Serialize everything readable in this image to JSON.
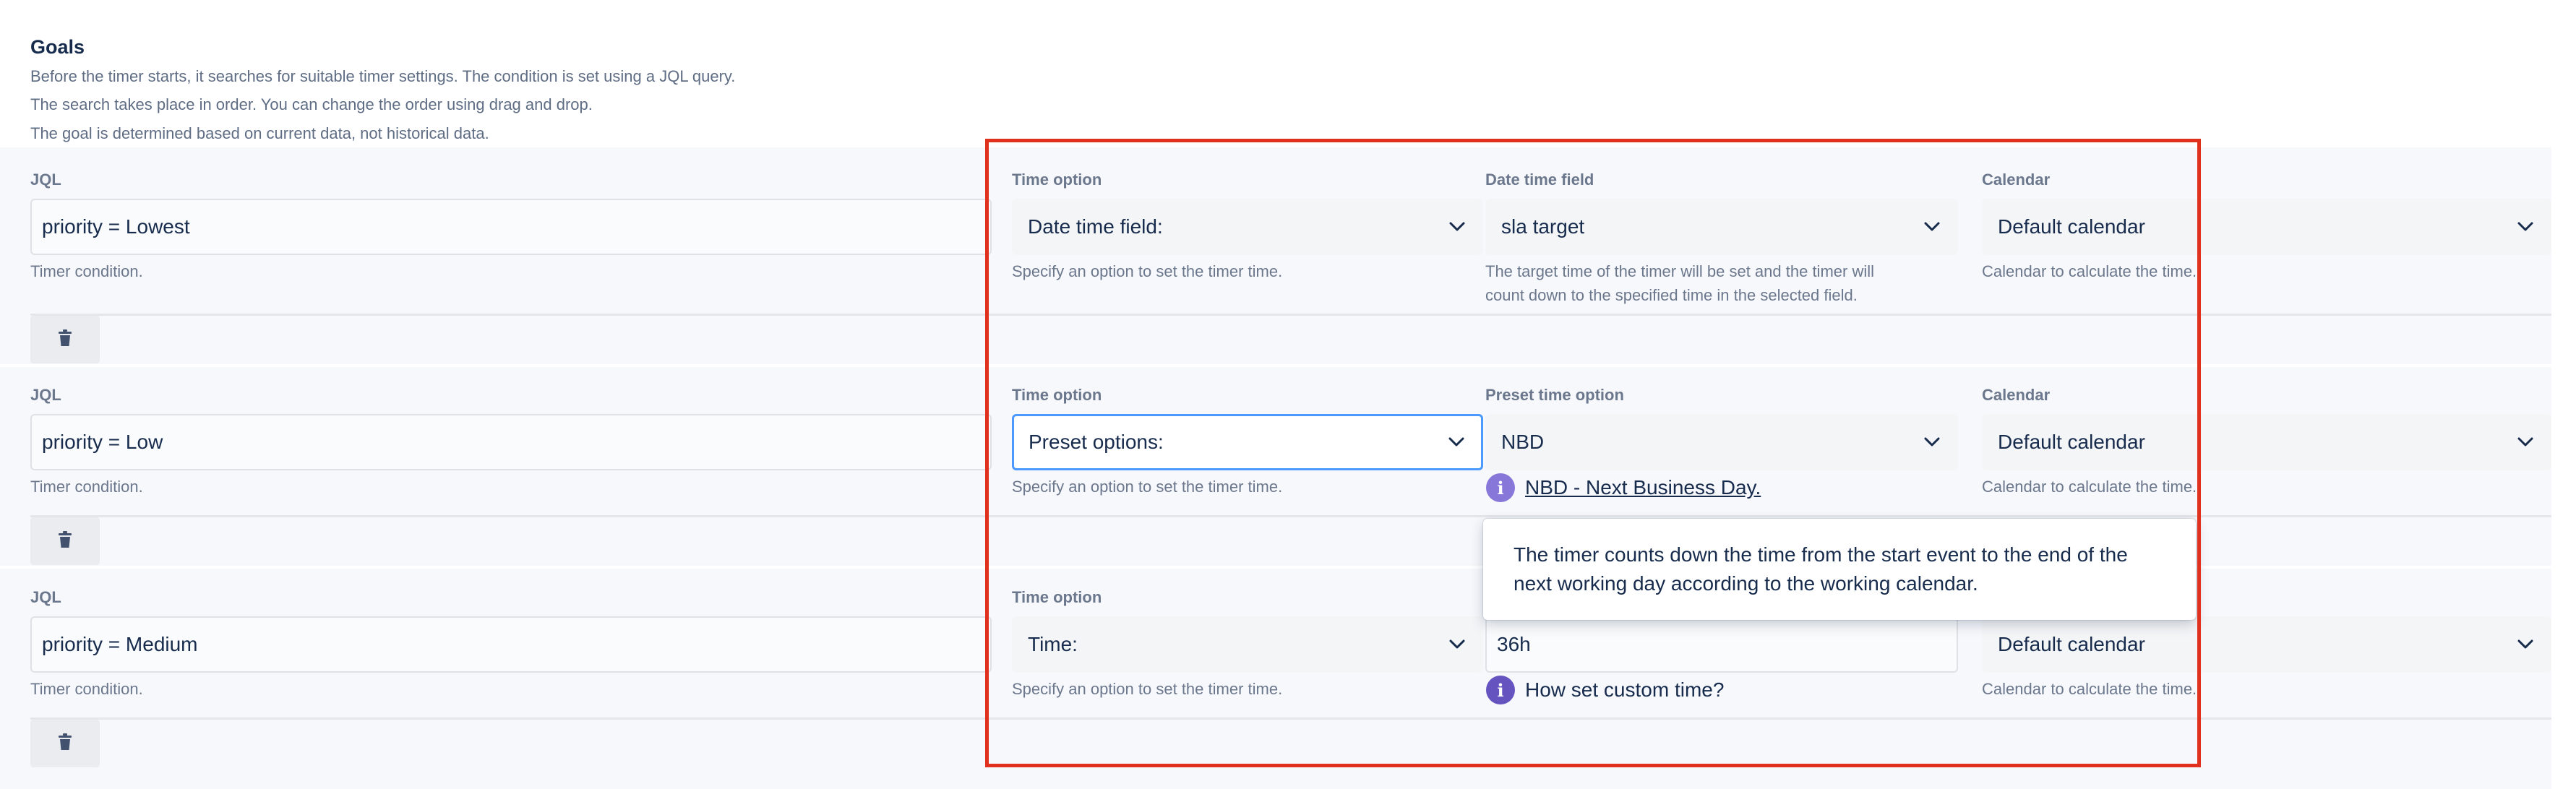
{
  "header": {
    "title": "Goals",
    "lines": [
      "Before the timer starts, it searches for suitable timer settings. The condition is set using a JQL query.",
      "The search takes place in order. You can change the order using drag and drop.",
      "The goal is determined based on current data, not historical data."
    ]
  },
  "rows": [
    {
      "jql_label": "JQL",
      "jql_value": "priority = Lowest",
      "jql_help": "Timer condition.",
      "time_option_label": "Time option",
      "time_option_value": "Date time field:",
      "time_option_help": "Specify an option to set the timer time.",
      "third_label": "Date time field",
      "third_value": "sla target",
      "third_help_line1": "The target time of the timer will be set and the timer will",
      "third_help_line2": "count down to the specified time in the selected field.",
      "calendar_label": "Calendar",
      "calendar_value": "Default calendar",
      "calendar_help": "Calendar to calculate the time."
    },
    {
      "jql_label": "JQL",
      "jql_value": "priority = Low",
      "jql_help": "Timer condition.",
      "time_option_label": "Time option",
      "time_option_value": "Preset options:",
      "time_option_help": "Specify an option to set the timer time.",
      "third_label": "Preset time option",
      "third_value": "NBD",
      "third_link": "NBD - Next Business Day.",
      "calendar_label": "Calendar",
      "calendar_value": "Default calendar",
      "calendar_help": "Calendar to calculate the time."
    },
    {
      "jql_label": "JQL",
      "jql_value": "priority = Medium",
      "jql_help": "Timer condition.",
      "time_option_label": "Time option",
      "time_option_value": "Time:",
      "time_option_help": "Specify an option to set the timer time.",
      "third_value": "36h",
      "third_link": "How set custom time?",
      "calendar_value": "Default calendar",
      "calendar_help": "Calendar to calculate the time."
    }
  ],
  "tooltip": {
    "line1": "The timer counts down the time from the start event to the end of the",
    "line2": "next working day according to the working calendar."
  },
  "colors": {
    "highlight": "#e0301e",
    "info_icon_row2": "#8777d9",
    "info_icon_row3": "#6554c0",
    "focus": "#4c9aff"
  },
  "icons": [
    "chevron-down-icon",
    "trash-icon",
    "info-icon"
  ]
}
